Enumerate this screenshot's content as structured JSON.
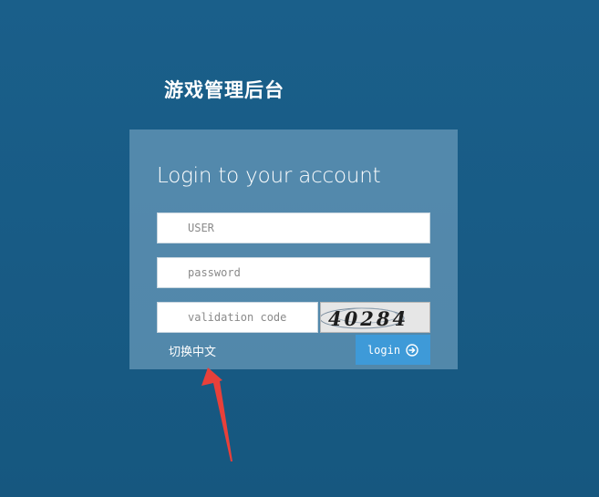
{
  "header": {
    "title": "游戏管理后台"
  },
  "login": {
    "heading": "Login to your account",
    "user_placeholder": "USER",
    "password_placeholder": "password",
    "code_placeholder": "validation code",
    "captcha_text": "40284",
    "switch_language_label": "切换中文",
    "login_label": "login",
    "login_icon": "arrow-circle-right-icon"
  },
  "colors": {
    "background": "#185b85",
    "panel": "#78a5c3",
    "button": "#3e9ad8",
    "annotation_arrow": "#e8403a"
  }
}
